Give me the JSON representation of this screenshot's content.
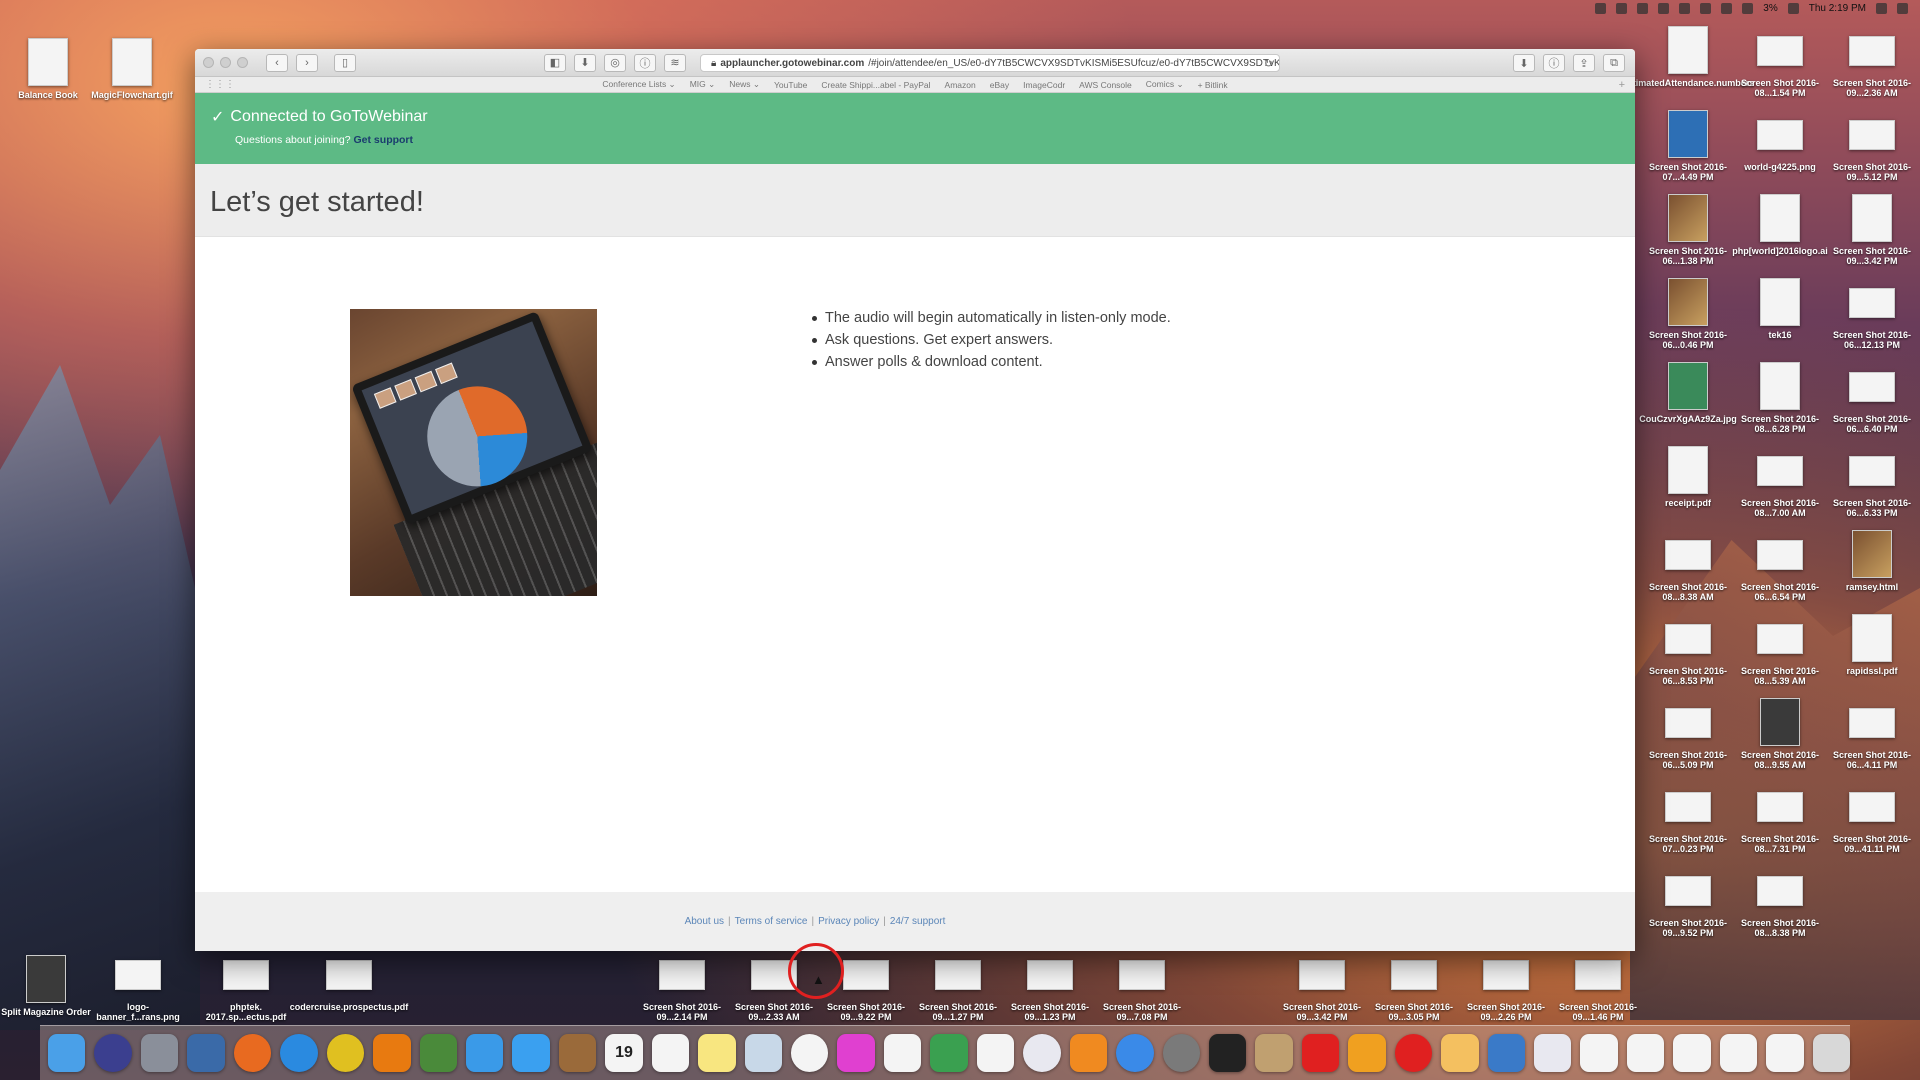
{
  "menubar": {
    "time": "Thu 2:19 PM",
    "battery": "3%"
  },
  "desktop_left": [
    {
      "label": "Balance Book"
    },
    {
      "label": "MagicFlowchart.gif"
    },
    {
      "label": "Split Magazine Order"
    },
    {
      "label": "logo-banner_f...rans.png"
    },
    {
      "label": "phptek. 2017.sp...ectus.pdf"
    },
    {
      "label": "codercruise.prospectus.pdf"
    }
  ],
  "desktop_right": [
    {
      "label": "EstimatedAttendance.numbers"
    },
    {
      "label": "Screen Shot 2016-08...1.54 PM"
    },
    {
      "label": "Screen Shot 2016-09...2.36 AM"
    },
    {
      "label": "Screen Shot 2016-07...4.49 PM"
    },
    {
      "label": "world-g4225.png"
    },
    {
      "label": "Screen Shot 2016-09...5.12 PM"
    },
    {
      "label": "Screen Shot 2016-06...1.38 PM"
    },
    {
      "label": "php[world]2016logo.ai"
    },
    {
      "label": "Screen Shot 2016-09...3.42 PM"
    },
    {
      "label": "Screen Shot 2016-06...0.46 PM"
    },
    {
      "label": "tek16"
    },
    {
      "label": "Screen Shot 2016-06...12.13 PM"
    },
    {
      "label": "CouCzvrXgAAz9Za.jpg"
    },
    {
      "label": "Screen Shot 2016-08...6.28 PM"
    },
    {
      "label": "Screen Shot 2016-06...6.40 PM"
    },
    {
      "label": "receipt.pdf"
    },
    {
      "label": "Screen Shot 2016-08...7.00 AM"
    },
    {
      "label": "Screen Shot 2016-06...6.33 PM"
    },
    {
      "label": "Screen Shot 2016-08...8.38 AM"
    },
    {
      "label": "Screen Shot 2016-06...6.54 PM"
    },
    {
      "label": "ramsey.html"
    },
    {
      "label": "Screen Shot 2016-06...8.53 PM"
    },
    {
      "label": "Screen Shot 2016-08...5.39 AM"
    },
    {
      "label": "rapidssl.pdf"
    },
    {
      "label": "Screen Shot 2016-06...5.09 PM"
    },
    {
      "label": "Screen Shot 2016-08...9.55 AM"
    },
    {
      "label": "Screen Shot 2016-06...4.11 PM"
    },
    {
      "label": "Screen Shot 2016-07...0.23 PM"
    },
    {
      "label": "Screen Shot 2016-08...7.31 PM"
    },
    {
      "label": "Screen Shot 2016-09...41.11 PM"
    },
    {
      "label": "Screen Shot 2016-09...9.52 PM"
    },
    {
      "label": "Screen Shot 2016-08...8.38 PM"
    }
  ],
  "desktop_bottom": [
    {
      "label": "Screen Shot 2016-09...2.14 PM"
    },
    {
      "label": "Screen Shot 2016-09...2.33 AM"
    },
    {
      "label": "Screen Shot 2016-09...9.22 PM"
    },
    {
      "label": "Screen Shot 2016-09...1.27 PM"
    },
    {
      "label": "Screen Shot 2016-09...1.23 PM"
    },
    {
      "label": "Screen Shot 2016-09...7.08 PM"
    },
    {
      "label": "Screen Shot 2016-09...3.42 PM"
    },
    {
      "label": "Screen Shot 2016-09...3.05 PM"
    },
    {
      "label": "Screen Shot 2016-09...2.26 PM"
    },
    {
      "label": "Screen Shot 2016-09...1.46 PM"
    }
  ],
  "browser": {
    "url_host": "applauncher.gotowebinar.com",
    "url_path": "/#join/attendee/en_US/e0-dY7tB5CWCVX9SDTvKISMi5ESUfcuz/e0-dY7tB5CWCVX9SDTvKISM",
    "bookmarks": [
      "Conference Lists ⌄",
      "MIG ⌄",
      "News ⌄",
      "YouTube",
      "Create Shippi...abel - PayPal",
      "Amazon",
      "eBay",
      "ImageCodr",
      "AWS Console",
      "Comics ⌄",
      "+ Bitlink"
    ]
  },
  "banner": {
    "status": "Connected to GoToWebinar",
    "question": "Questions about joining?",
    "support_link": "Get support",
    "color": "#5dba85"
  },
  "page": {
    "title": "Let’s get started!",
    "bullets": [
      "The audio will begin automatically in listen-only mode.",
      "Ask questions. Get expert answers.",
      "Answer polls & download content."
    ]
  },
  "footer": {
    "links": [
      "About us",
      "Terms of service",
      "Privacy policy",
      "24/7 support"
    ]
  },
  "dock": {
    "calendar_month": "OCT",
    "calendar_day": "19",
    "apps": [
      "finder-icon",
      "siri-icon",
      "launchpad-icon",
      "thunderbird-icon",
      "firefox-icon",
      "safari-icon",
      "chrome-icon",
      "vlc-icon",
      "tree-icon",
      "messages-icon",
      "twitter-icon",
      "book-icon",
      "calendar-icon",
      "reminders-icon",
      "notes-icon",
      "preview-icon",
      "photos-icon",
      "flower-icon",
      "pages-icon",
      "numbers-icon",
      "keynote-icon",
      "itunes-icon",
      "ibooks-icon",
      "app-store-icon",
      "system-preferences-icon",
      "terminal-icon",
      "paint-icon",
      "sublime-icon",
      "filezilla-icon",
      "opera-icon",
      "pinwheel-icon",
      "folder-icon",
      "stack-icon",
      "doc-icon",
      "doc-icon",
      "doc-icon",
      "doc-icon",
      "doc-icon",
      "trash-icon"
    ]
  }
}
